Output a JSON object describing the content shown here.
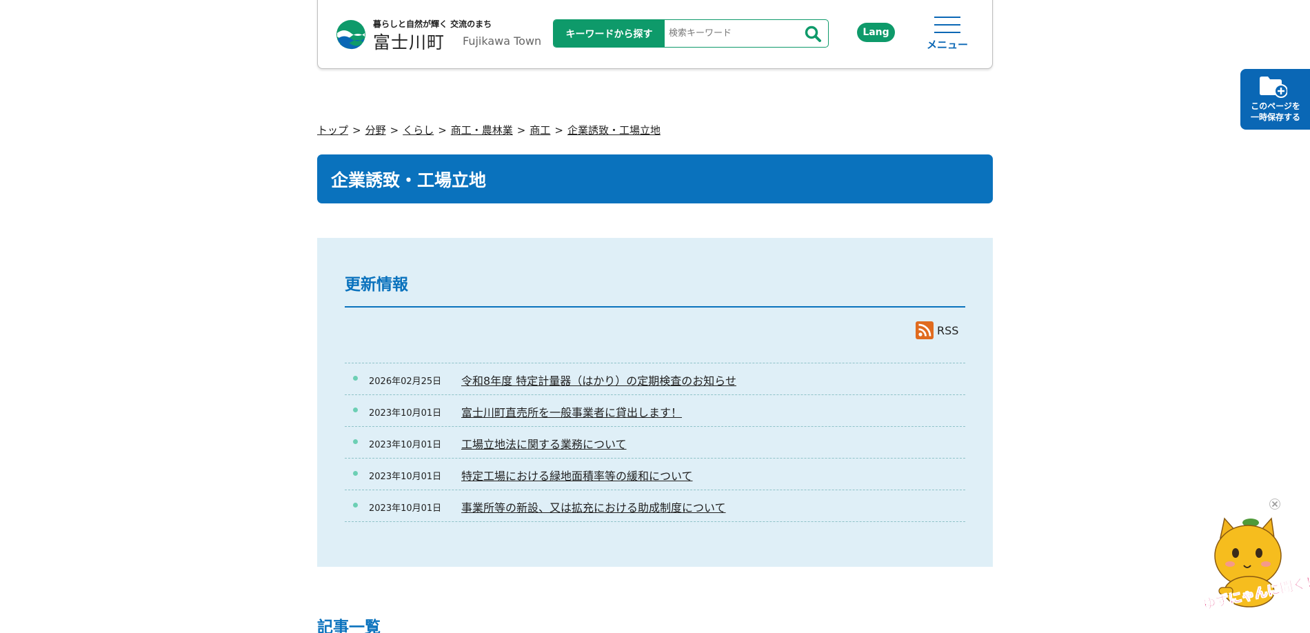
{
  "header": {
    "tagline": "暮らしと自然が輝く 交流のまち",
    "town_name": "富士川町",
    "town_name_en": "Fujikawa Town",
    "search_label": "キーワードから探す",
    "search_placeholder": "検索キーワード",
    "search_value": "",
    "lang_label": "Lang",
    "menu_label": "メニュー"
  },
  "side": {
    "save_label_line1": "このページを",
    "save_label_line2": "一時保存する"
  },
  "breadcrumb": {
    "items": [
      "トップ",
      "分野",
      "くらし",
      "商工・農林業",
      "商工",
      "企業誘致・工場立地"
    ],
    "separator": ">"
  },
  "page": {
    "title": "企業誘致・工場立地"
  },
  "updates": {
    "heading": "更新情報",
    "rss_label": "RSS",
    "items": [
      {
        "date": "2026年02月25日",
        "title": "令和8年度 特定計量器（はかり）の定期検査のお知らせ"
      },
      {
        "date": "2023年10月01日",
        "title": "富士川町直売所を一般事業者に貸出します！"
      },
      {
        "date": "2023年10月01日",
        "title": "工場立地法に関する業務について"
      },
      {
        "date": "2023年10月01日",
        "title": "特定工場における緑地面積率等の緩和について"
      },
      {
        "date": "2023年10月01日",
        "title": "事業所等の新設、又は拡充における助成制度について"
      }
    ]
  },
  "articles": {
    "heading": "記事一覧"
  },
  "mascot": {
    "caption": "ゆずにゃんに聞く！"
  },
  "colors": {
    "brand_blue": "#0a72bd",
    "brand_green": "#0e9a6a",
    "panel_bg": "#dfeff7",
    "rss_orange": "#e06b1f"
  }
}
